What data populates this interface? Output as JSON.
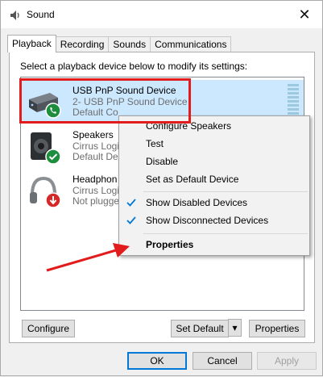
{
  "window": {
    "title": "Sound",
    "title_icon": "speaker-icon",
    "close_icon": "close-icon",
    "close_glyph": "✕"
  },
  "tabs": [
    {
      "label": "Playback",
      "active": true
    },
    {
      "label": "Recording",
      "active": false
    },
    {
      "label": "Sounds",
      "active": false
    },
    {
      "label": "Communications",
      "active": false
    }
  ],
  "instruction": "Select a playback device below to modify its settings:",
  "devices": [
    {
      "name": "USB PnP Sound Device",
      "sub": "2- USB PnP Sound Device",
      "status": "Default Co",
      "icon": "usb-sound-card-icon",
      "badge": "phone-badge-icon",
      "selected": true
    },
    {
      "name": "Speakers",
      "sub": "Cirrus Logi",
      "status": "Default De",
      "icon": "speaker-device-icon",
      "badge": "check-badge-icon",
      "selected": false
    },
    {
      "name": "Headphon",
      "sub": "Cirrus Logi",
      "status": "Not plugge",
      "icon": "headphones-icon",
      "badge": "unplugged-badge-icon",
      "selected": false
    }
  ],
  "context_menu": {
    "items": [
      {
        "label": "Configure Speakers",
        "checked": false,
        "bold": false
      },
      {
        "label": "Test",
        "checked": false,
        "bold": false
      },
      {
        "label": "Disable",
        "checked": false,
        "bold": false
      },
      {
        "label": "Set as Default Device",
        "checked": false,
        "bold": false
      },
      {
        "label": "Show Disabled Devices",
        "checked": true,
        "bold": false
      },
      {
        "label": "Show Disconnected Devices",
        "checked": true,
        "bold": false
      },
      {
        "label": "Properties",
        "checked": false,
        "bold": true
      }
    ]
  },
  "buttons": {
    "configure": "Configure",
    "set_default": "Set Default",
    "set_default_arrow": "▾",
    "properties": "Properties",
    "ok": "OK",
    "cancel": "Cancel",
    "apply": "Apply"
  },
  "annotations": {
    "highlight_color": "#e21c1c",
    "arrow_color": "#e21c1c"
  },
  "colors": {
    "selection": "#cce8ff",
    "check": "#0078d7",
    "accent": "#0078d7"
  }
}
